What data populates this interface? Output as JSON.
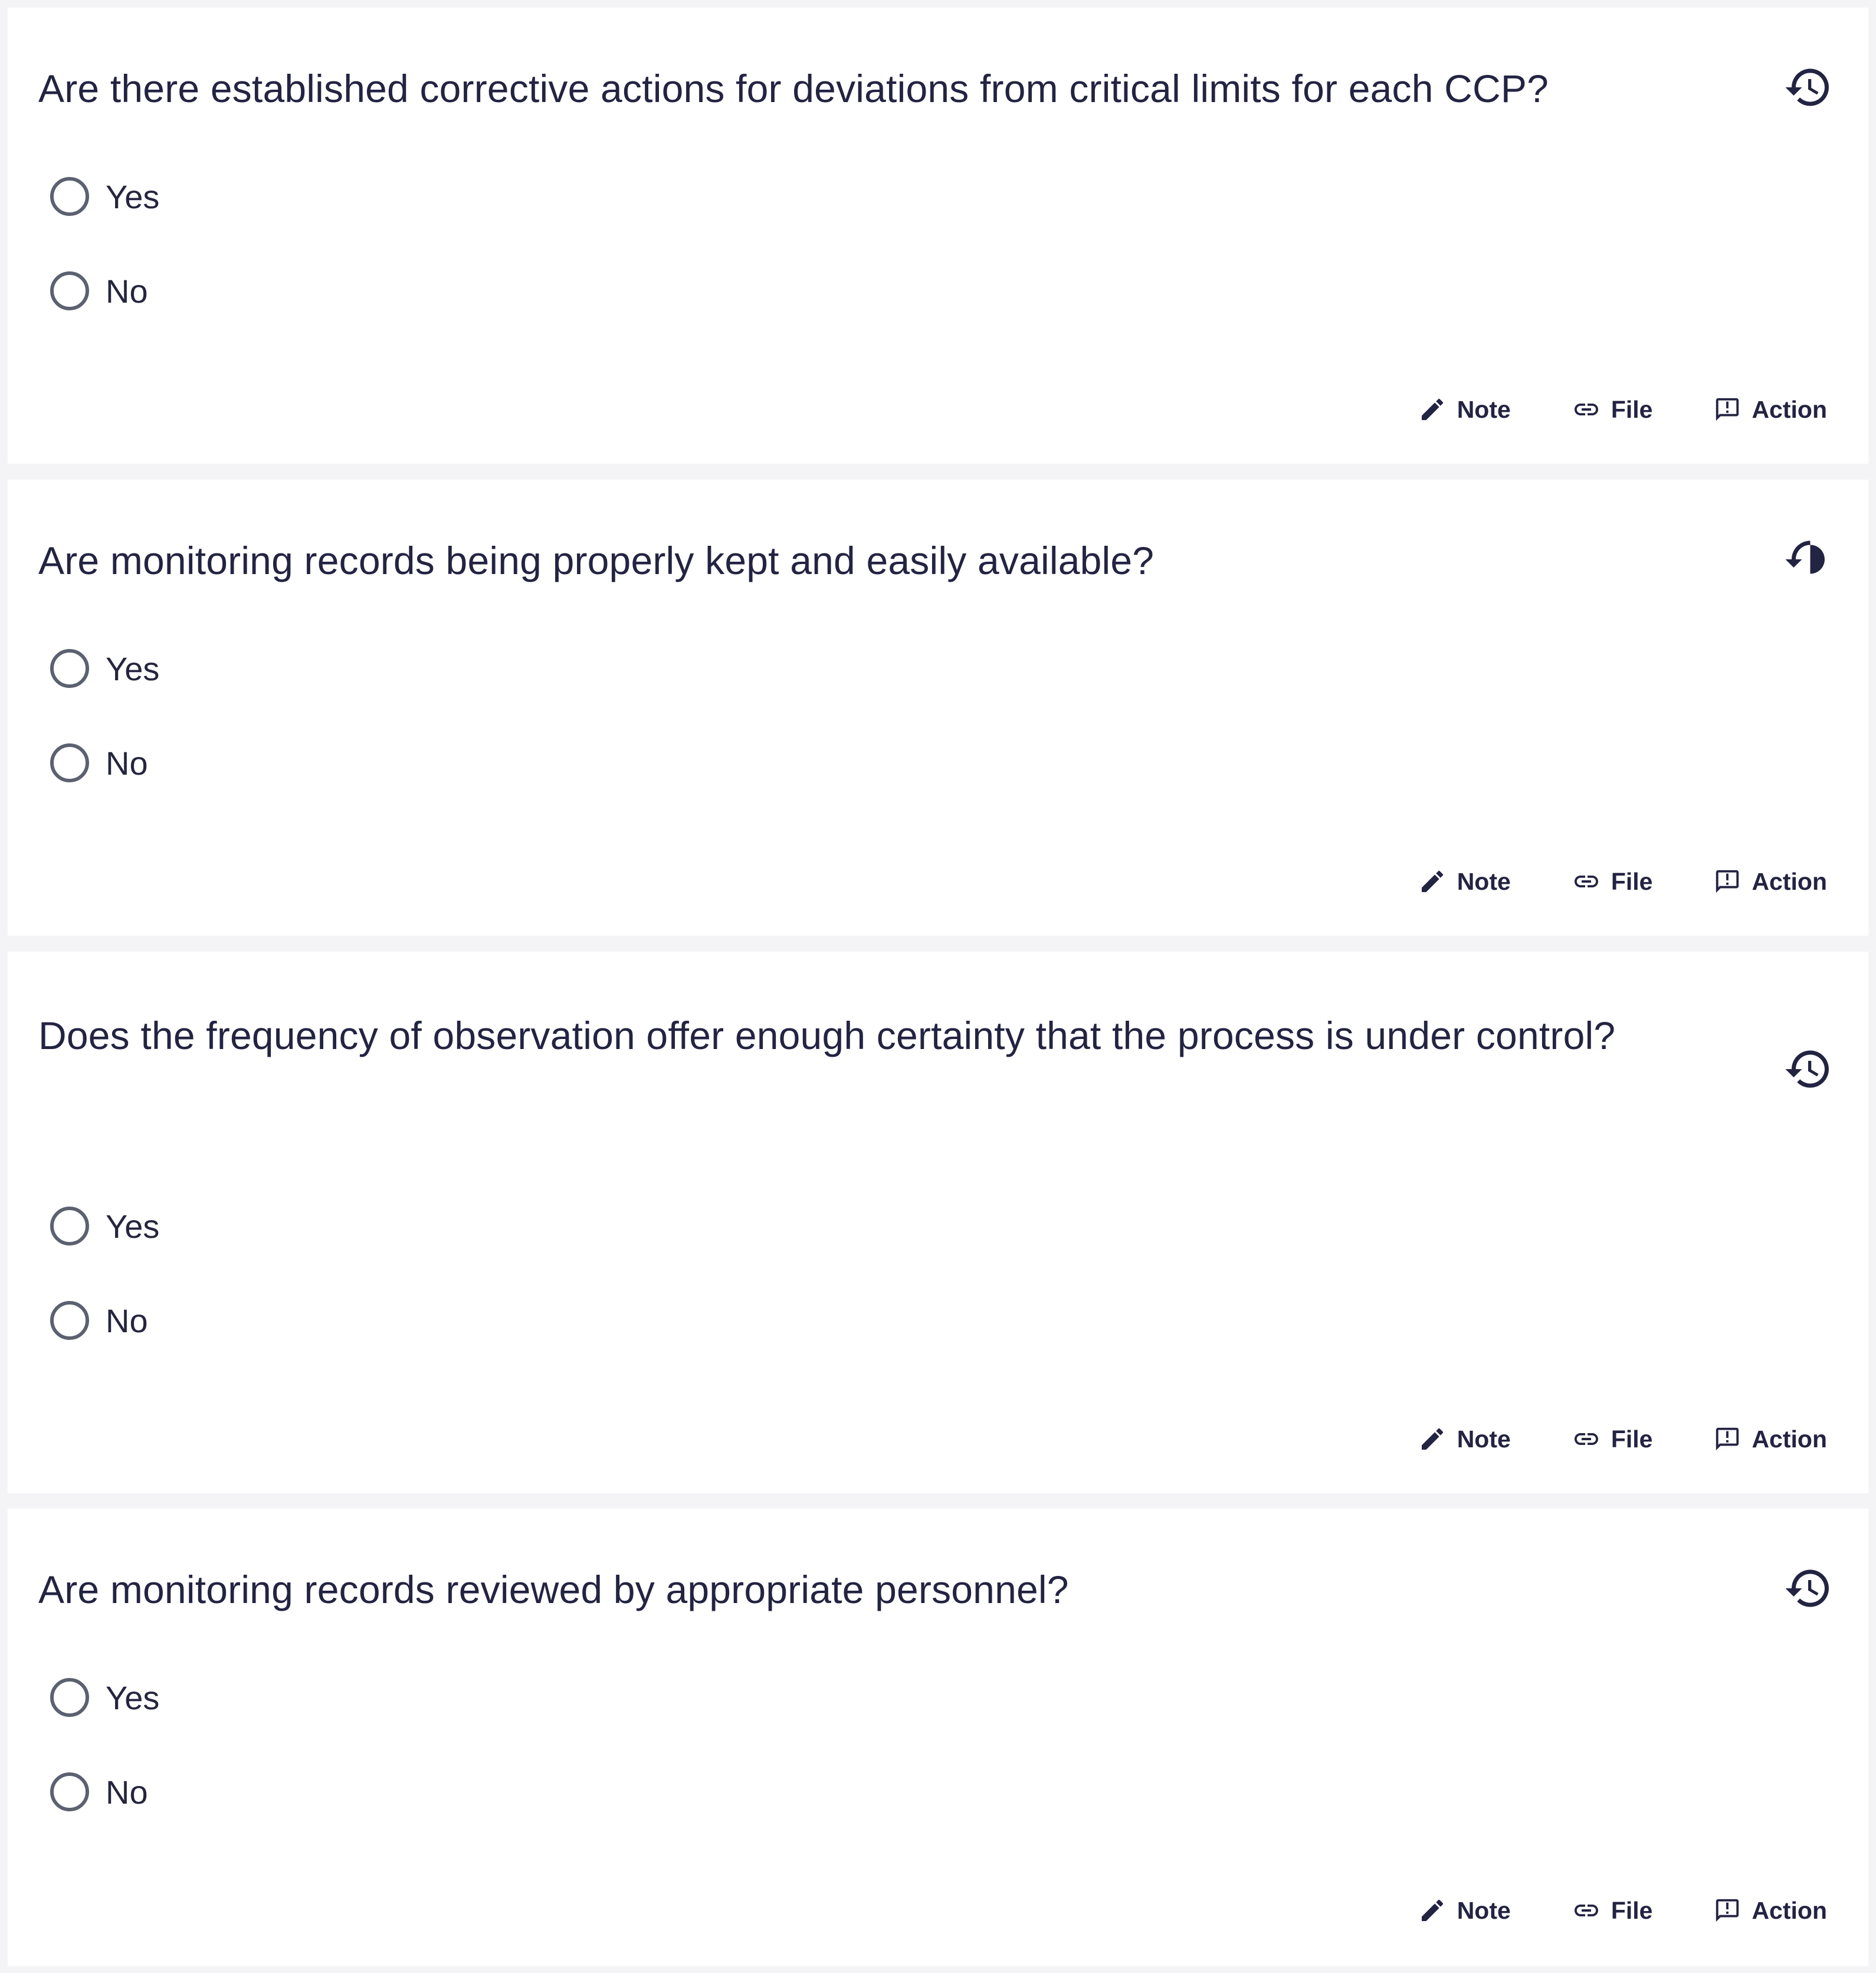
{
  "colors": {
    "background": "#f4f4f7",
    "card": "#ffffff",
    "text": "#232342",
    "radio_border": "#5c6170"
  },
  "icons": {
    "history": "history-icon",
    "note": "pencil-icon",
    "file": "paperclip-icon",
    "action": "comment-alert-icon"
  },
  "questions": [
    {
      "text": "Are there established corrective actions for deviations from critical limits for each CCP?",
      "options": [
        "Yes",
        "No"
      ],
      "footer": {
        "note": "Note",
        "file": "File",
        "action": "Action"
      }
    },
    {
      "text": "Are monitoring records being properly kept and easily available?",
      "options": [
        "Yes",
        "No"
      ],
      "footer": {
        "note": "Note",
        "file": "File",
        "action": "Action"
      }
    },
    {
      "text": "Does the frequency of observation offer enough certainty that the process is under control?",
      "options": [
        "Yes",
        "No"
      ],
      "footer": {
        "note": "Note",
        "file": "File",
        "action": "Action"
      }
    },
    {
      "text": "Are monitoring records reviewed by appropriate personnel?",
      "options": [
        "Yes",
        "No"
      ],
      "footer": {
        "note": "Note",
        "file": "File",
        "action": "Action"
      }
    }
  ]
}
